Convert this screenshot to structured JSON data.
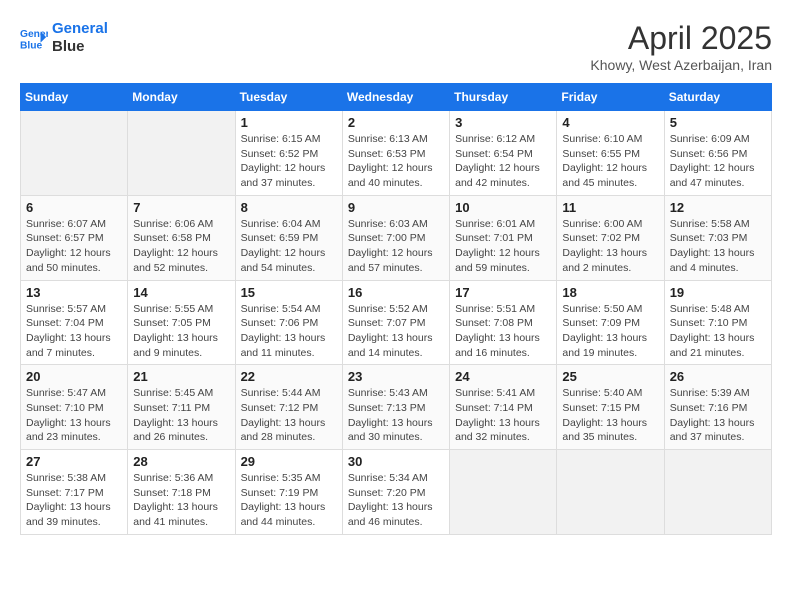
{
  "header": {
    "logo_line1": "General",
    "logo_line2": "Blue",
    "main_title": "April 2025",
    "subtitle": "Khowy, West Azerbaijan, Iran"
  },
  "weekdays": [
    "Sunday",
    "Monday",
    "Tuesday",
    "Wednesday",
    "Thursday",
    "Friday",
    "Saturday"
  ],
  "weeks": [
    [
      {
        "day": "",
        "info": ""
      },
      {
        "day": "",
        "info": ""
      },
      {
        "day": "1",
        "info": "Sunrise: 6:15 AM\nSunset: 6:52 PM\nDaylight: 12 hours and 37 minutes."
      },
      {
        "day": "2",
        "info": "Sunrise: 6:13 AM\nSunset: 6:53 PM\nDaylight: 12 hours and 40 minutes."
      },
      {
        "day": "3",
        "info": "Sunrise: 6:12 AM\nSunset: 6:54 PM\nDaylight: 12 hours and 42 minutes."
      },
      {
        "day": "4",
        "info": "Sunrise: 6:10 AM\nSunset: 6:55 PM\nDaylight: 12 hours and 45 minutes."
      },
      {
        "day": "5",
        "info": "Sunrise: 6:09 AM\nSunset: 6:56 PM\nDaylight: 12 hours and 47 minutes."
      }
    ],
    [
      {
        "day": "6",
        "info": "Sunrise: 6:07 AM\nSunset: 6:57 PM\nDaylight: 12 hours and 50 minutes."
      },
      {
        "day": "7",
        "info": "Sunrise: 6:06 AM\nSunset: 6:58 PM\nDaylight: 12 hours and 52 minutes."
      },
      {
        "day": "8",
        "info": "Sunrise: 6:04 AM\nSunset: 6:59 PM\nDaylight: 12 hours and 54 minutes."
      },
      {
        "day": "9",
        "info": "Sunrise: 6:03 AM\nSunset: 7:00 PM\nDaylight: 12 hours and 57 minutes."
      },
      {
        "day": "10",
        "info": "Sunrise: 6:01 AM\nSunset: 7:01 PM\nDaylight: 12 hours and 59 minutes."
      },
      {
        "day": "11",
        "info": "Sunrise: 6:00 AM\nSunset: 7:02 PM\nDaylight: 13 hours and 2 minutes."
      },
      {
        "day": "12",
        "info": "Sunrise: 5:58 AM\nSunset: 7:03 PM\nDaylight: 13 hours and 4 minutes."
      }
    ],
    [
      {
        "day": "13",
        "info": "Sunrise: 5:57 AM\nSunset: 7:04 PM\nDaylight: 13 hours and 7 minutes."
      },
      {
        "day": "14",
        "info": "Sunrise: 5:55 AM\nSunset: 7:05 PM\nDaylight: 13 hours and 9 minutes."
      },
      {
        "day": "15",
        "info": "Sunrise: 5:54 AM\nSunset: 7:06 PM\nDaylight: 13 hours and 11 minutes."
      },
      {
        "day": "16",
        "info": "Sunrise: 5:52 AM\nSunset: 7:07 PM\nDaylight: 13 hours and 14 minutes."
      },
      {
        "day": "17",
        "info": "Sunrise: 5:51 AM\nSunset: 7:08 PM\nDaylight: 13 hours and 16 minutes."
      },
      {
        "day": "18",
        "info": "Sunrise: 5:50 AM\nSunset: 7:09 PM\nDaylight: 13 hours and 19 minutes."
      },
      {
        "day": "19",
        "info": "Sunrise: 5:48 AM\nSunset: 7:10 PM\nDaylight: 13 hours and 21 minutes."
      }
    ],
    [
      {
        "day": "20",
        "info": "Sunrise: 5:47 AM\nSunset: 7:10 PM\nDaylight: 13 hours and 23 minutes."
      },
      {
        "day": "21",
        "info": "Sunrise: 5:45 AM\nSunset: 7:11 PM\nDaylight: 13 hours and 26 minutes."
      },
      {
        "day": "22",
        "info": "Sunrise: 5:44 AM\nSunset: 7:12 PM\nDaylight: 13 hours and 28 minutes."
      },
      {
        "day": "23",
        "info": "Sunrise: 5:43 AM\nSunset: 7:13 PM\nDaylight: 13 hours and 30 minutes."
      },
      {
        "day": "24",
        "info": "Sunrise: 5:41 AM\nSunset: 7:14 PM\nDaylight: 13 hours and 32 minutes."
      },
      {
        "day": "25",
        "info": "Sunrise: 5:40 AM\nSunset: 7:15 PM\nDaylight: 13 hours and 35 minutes."
      },
      {
        "day": "26",
        "info": "Sunrise: 5:39 AM\nSunset: 7:16 PM\nDaylight: 13 hours and 37 minutes."
      }
    ],
    [
      {
        "day": "27",
        "info": "Sunrise: 5:38 AM\nSunset: 7:17 PM\nDaylight: 13 hours and 39 minutes."
      },
      {
        "day": "28",
        "info": "Sunrise: 5:36 AM\nSunset: 7:18 PM\nDaylight: 13 hours and 41 minutes."
      },
      {
        "day": "29",
        "info": "Sunrise: 5:35 AM\nSunset: 7:19 PM\nDaylight: 13 hours and 44 minutes."
      },
      {
        "day": "30",
        "info": "Sunrise: 5:34 AM\nSunset: 7:20 PM\nDaylight: 13 hours and 46 minutes."
      },
      {
        "day": "",
        "info": ""
      },
      {
        "day": "",
        "info": ""
      },
      {
        "day": "",
        "info": ""
      }
    ]
  ]
}
